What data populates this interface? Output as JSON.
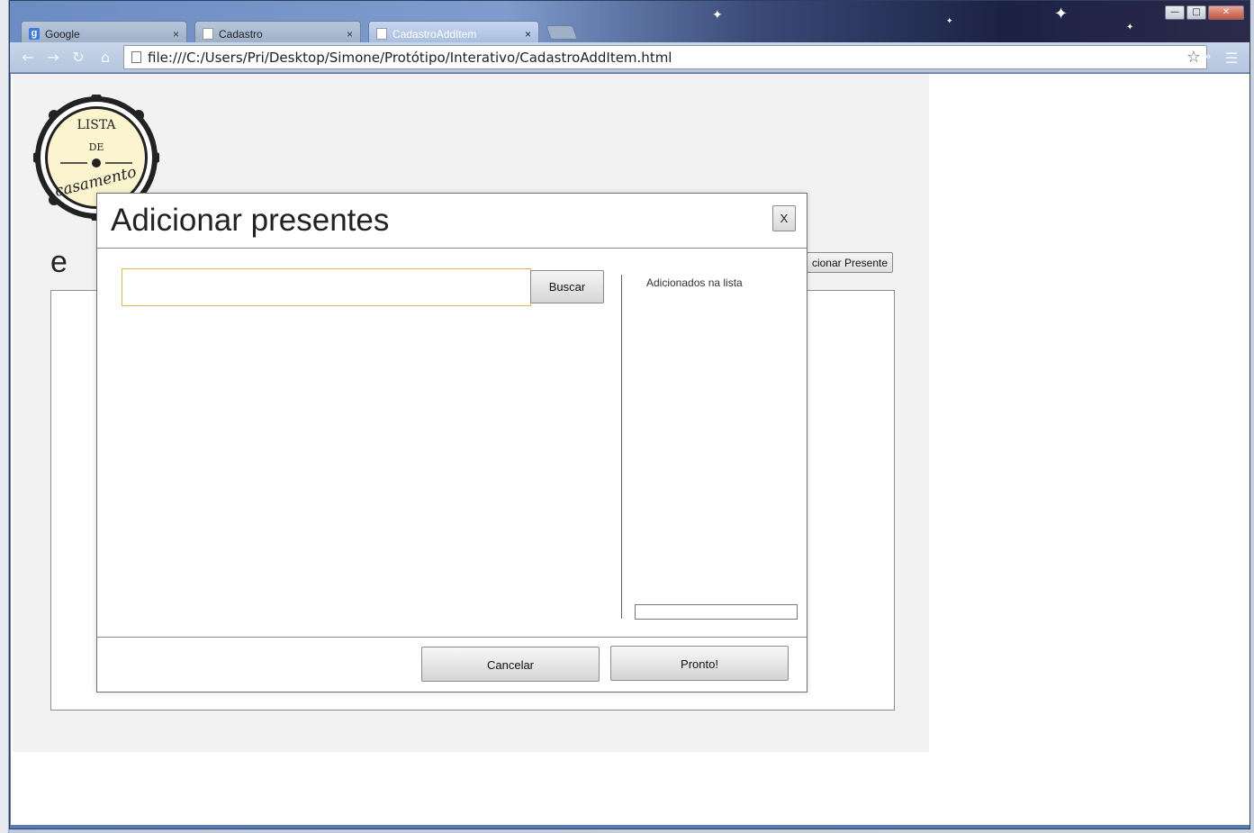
{
  "browser": {
    "tabs": [
      {
        "label": "Google",
        "icon": "google-icon"
      },
      {
        "label": "Cadastro",
        "icon": "page-icon"
      },
      {
        "label": "CadastroAddItem",
        "icon": "page-icon",
        "active": true
      }
    ],
    "tab_close_glyph": "×",
    "address_url": "file:///C:/Users/Pri/Desktop/Simone/Protótipo/Interativo/CadastroAddItem.html",
    "window_controls": {
      "minimize": "—",
      "maximize": "□",
      "close": "✕"
    }
  },
  "page": {
    "logo_text": {
      "top": "LISTA",
      "middle": "DE",
      "bottom": "casamento"
    },
    "heading_fragment": "e",
    "add_gift_button_fragment": "cionar Presente"
  },
  "modal": {
    "title": "Adicionar presentes",
    "close_label": "X",
    "search_placeholder": "",
    "search_button": "Buscar",
    "added_label": "Adicionados na lista",
    "cancel_button": "Cancelar",
    "done_button": "Pronto!"
  },
  "colors": {
    "window_frame": "#5a7bb0",
    "page_background": "#f2f2f2",
    "search_focus_border": "#e3b34c"
  }
}
